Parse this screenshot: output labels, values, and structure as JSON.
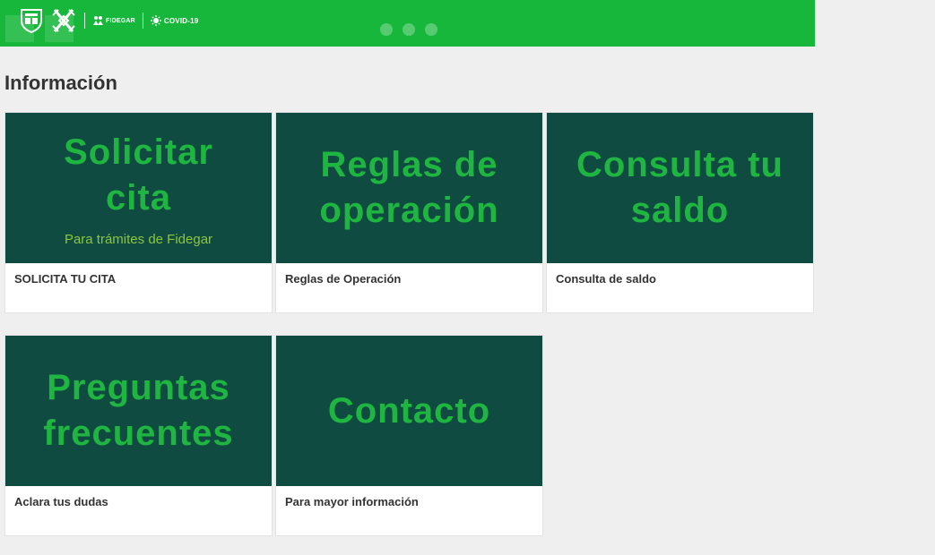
{
  "banner": {
    "color": "#17b73b",
    "logos": {
      "fidegar": "FIDEGAR",
      "covid": "COVID-19"
    },
    "slide_dots": 3
  },
  "section": {
    "title": "Información"
  },
  "cards": [
    {
      "headline": "Solicitar\ncita",
      "subheadline": "Para trámites de Fidegar",
      "caption": "SOLICITA TU CITA"
    },
    {
      "headline": "Reglas de\noperación",
      "caption": "Reglas de Operación"
    },
    {
      "headline": "Consulta tu\nsaldo",
      "caption": "Consulta de saldo"
    },
    {
      "headline": "Preguntas\nfrecuentes",
      "caption": "Aclara tus dudas"
    },
    {
      "headline": "Contacto",
      "caption": "Para mayor información"
    }
  ],
  "colors": {
    "card_background": "#0f4b41",
    "headline_green": "#1fb541",
    "subheadline_green": "#8cc63e",
    "page_background": "#efefef"
  }
}
